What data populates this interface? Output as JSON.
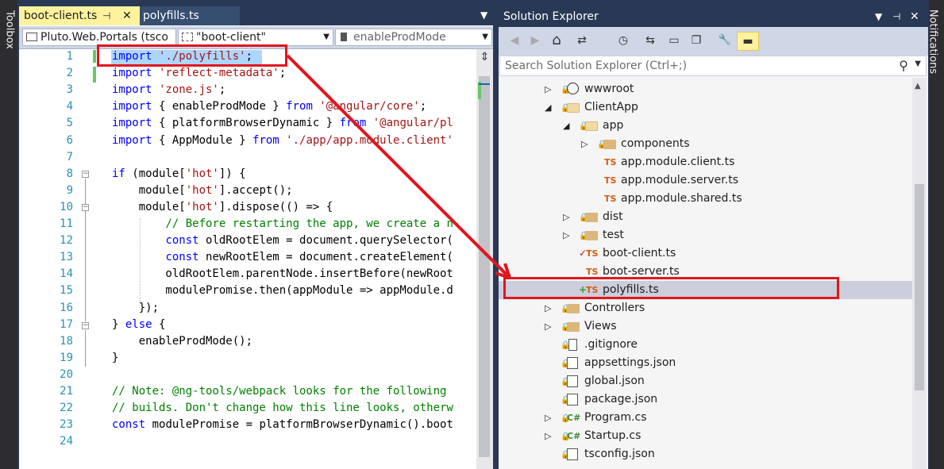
{
  "sidebars": {
    "toolbox": "Toolbox",
    "notifications": "Notifications"
  },
  "editor": {
    "tabs": [
      {
        "label": "boot-client.ts",
        "pin": "⊣",
        "close": "✕"
      },
      {
        "label": "polyfills.ts"
      }
    ],
    "tab_dropdown": "▼",
    "nav": {
      "project": "Pluto.Web.Portals (tsco",
      "scope": "\"boot-client\"",
      "member": "enableProdMode"
    },
    "split_icon": "⇕",
    "lines": [
      {
        "n": "1",
        "tokens": [
          [
            "kw",
            "import"
          ],
          [
            "",
            ""
          ],
          [
            "str",
            " './polyfills'"
          ],
          [
            "",
            ";"
          ]
        ]
      },
      {
        "n": "2",
        "tokens": [
          [
            "kw",
            "import"
          ],
          [
            "str",
            " 'reflect-metadata'"
          ],
          [
            "",
            ";"
          ]
        ]
      },
      {
        "n": "3",
        "tokens": [
          [
            "kw",
            "import"
          ],
          [
            "str",
            " 'zone.js'"
          ],
          [
            "",
            ";"
          ]
        ]
      },
      {
        "n": "4",
        "tokens": [
          [
            "kw",
            "import"
          ],
          [
            "",
            " { enableProdMode } "
          ],
          [
            "kw",
            "from"
          ],
          [
            "str",
            " '@angular/core'"
          ],
          [
            "",
            ";"
          ]
        ]
      },
      {
        "n": "5",
        "tokens": [
          [
            "kw",
            "import"
          ],
          [
            "",
            " { platformBrowserDynamic } "
          ],
          [
            "kw",
            "from"
          ],
          [
            "str",
            " '@angular/pl"
          ]
        ]
      },
      {
        "n": "6",
        "tokens": [
          [
            "kw",
            "import"
          ],
          [
            "",
            " { AppModule } "
          ],
          [
            "kw",
            "from"
          ],
          [
            "str",
            " './app/app.module.client'"
          ]
        ]
      },
      {
        "n": "7",
        "tokens": []
      },
      {
        "n": "8",
        "tokens": [
          [
            "kw",
            "if"
          ],
          [
            "",
            " (module["
          ],
          [
            "str",
            "'hot'"
          ],
          [
            "",
            "]) {"
          ]
        ]
      },
      {
        "n": "9",
        "tokens": [
          [
            "",
            "    module["
          ],
          [
            "str",
            "'hot'"
          ],
          [
            "",
            "].accept();"
          ]
        ]
      },
      {
        "n": "10",
        "tokens": [
          [
            "",
            "    module["
          ],
          [
            "str",
            "'hot'"
          ],
          [
            "",
            "].dispose(() => {"
          ]
        ]
      },
      {
        "n": "11",
        "tokens": [
          [
            "",
            "        "
          ],
          [
            "cm",
            "// Before restarting the app, we create a n"
          ]
        ]
      },
      {
        "n": "12",
        "tokens": [
          [
            "",
            "        "
          ],
          [
            "kw",
            "const"
          ],
          [
            "",
            " oldRootElem = document.querySelector("
          ]
        ]
      },
      {
        "n": "13",
        "tokens": [
          [
            "",
            "        "
          ],
          [
            "kw",
            "const"
          ],
          [
            "",
            " newRootElem = document.createElement("
          ]
        ]
      },
      {
        "n": "14",
        "tokens": [
          [
            "",
            "        oldRootElem.parentNode.insertBefore(newRoot"
          ]
        ]
      },
      {
        "n": "15",
        "tokens": [
          [
            "",
            "        modulePromise.then(appModule => appModule.d"
          ]
        ]
      },
      {
        "n": "16",
        "tokens": [
          [
            "",
            "    });"
          ]
        ]
      },
      {
        "n": "17",
        "tokens": [
          [
            "",
            "} "
          ],
          [
            "kw",
            "else"
          ],
          [
            "",
            " {"
          ]
        ]
      },
      {
        "n": "18",
        "tokens": [
          [
            "",
            "    enableProdMode();"
          ]
        ]
      },
      {
        "n": "19",
        "tokens": [
          [
            "",
            "}"
          ]
        ]
      },
      {
        "n": "20",
        "tokens": []
      },
      {
        "n": "21",
        "tokens": [
          [
            "cm",
            "// Note: @ng-tools/webpack looks for the following"
          ]
        ]
      },
      {
        "n": "22",
        "tokens": [
          [
            "cm",
            "// builds. Don't change how this line looks, otherw"
          ]
        ]
      },
      {
        "n": "23",
        "tokens": [
          [
            "kw",
            "const"
          ],
          [
            "",
            " modulePromise = platformBrowserDynamic().boot"
          ]
        ]
      },
      {
        "n": "24",
        "tokens": []
      }
    ]
  },
  "solution_explorer": {
    "title": "Solution Explorer",
    "title_controls": [
      "▼",
      "⊣",
      "✕"
    ],
    "toolbar_icons": [
      "back-icon",
      "forward-icon",
      "home-icon",
      "sync-icon",
      "history-icon",
      "switch-icon",
      "collapse-icon",
      "copy-icon",
      "properties-icon",
      "preview-icon"
    ],
    "toolbar_glyphs": [
      "◀",
      "▶",
      "⌂",
      "⇄",
      "◷",
      "⇆",
      "▭",
      "❐",
      "🔧",
      "▬"
    ],
    "search_placeholder": "Search Solution Explorer (Ctrl+;)",
    "search_icon": "⚲",
    "tree": [
      {
        "label": "wwwroot",
        "kind": "globe",
        "level": 0,
        "exp": "right"
      },
      {
        "label": "ClientApp",
        "kind": "folder-open",
        "level": 0,
        "exp": "down"
      },
      {
        "label": "app",
        "kind": "folder-open",
        "level": 1,
        "exp": "down"
      },
      {
        "label": "components",
        "kind": "folder",
        "level": 2,
        "exp": "right"
      },
      {
        "label": "app.module.client.ts",
        "kind": "ts",
        "level": 2,
        "exp": ""
      },
      {
        "label": "app.module.server.ts",
        "kind": "ts",
        "level": 2,
        "exp": ""
      },
      {
        "label": "app.module.shared.ts",
        "kind": "ts",
        "level": 2,
        "exp": ""
      },
      {
        "label": "dist",
        "kind": "folder",
        "level": 1,
        "exp": "right"
      },
      {
        "label": "test",
        "kind": "folder",
        "level": 1,
        "exp": "right"
      },
      {
        "label": "boot-client.ts",
        "kind": "ts-check",
        "level": 1,
        "exp": ""
      },
      {
        "label": "boot-server.ts",
        "kind": "ts",
        "level": 1,
        "exp": ""
      },
      {
        "label": "polyfills.ts",
        "kind": "ts-plus",
        "level": 1,
        "exp": "",
        "selected": true
      },
      {
        "label": "Controllers",
        "kind": "folder",
        "level": 0,
        "exp": "right"
      },
      {
        "label": "Views",
        "kind": "folder",
        "level": 0,
        "exp": "right"
      },
      {
        "label": ".gitignore",
        "kind": "doc",
        "level": 0,
        "exp": ""
      },
      {
        "label": "appsettings.json",
        "kind": "json",
        "level": 0,
        "exp": ""
      },
      {
        "label": "global.json",
        "kind": "json",
        "level": 0,
        "exp": ""
      },
      {
        "label": "package.json",
        "kind": "json",
        "level": 0,
        "exp": ""
      },
      {
        "label": "Program.cs",
        "kind": "cs",
        "level": 0,
        "exp": "right"
      },
      {
        "label": "Startup.cs",
        "kind": "cs",
        "level": 0,
        "exp": "right"
      },
      {
        "label": "tsconfig.json",
        "kind": "json",
        "level": 0,
        "exp": ""
      }
    ]
  },
  "colors": {
    "annotation": "#e0161e",
    "accent_tab": "#fff29d",
    "chrome": "#293955"
  }
}
